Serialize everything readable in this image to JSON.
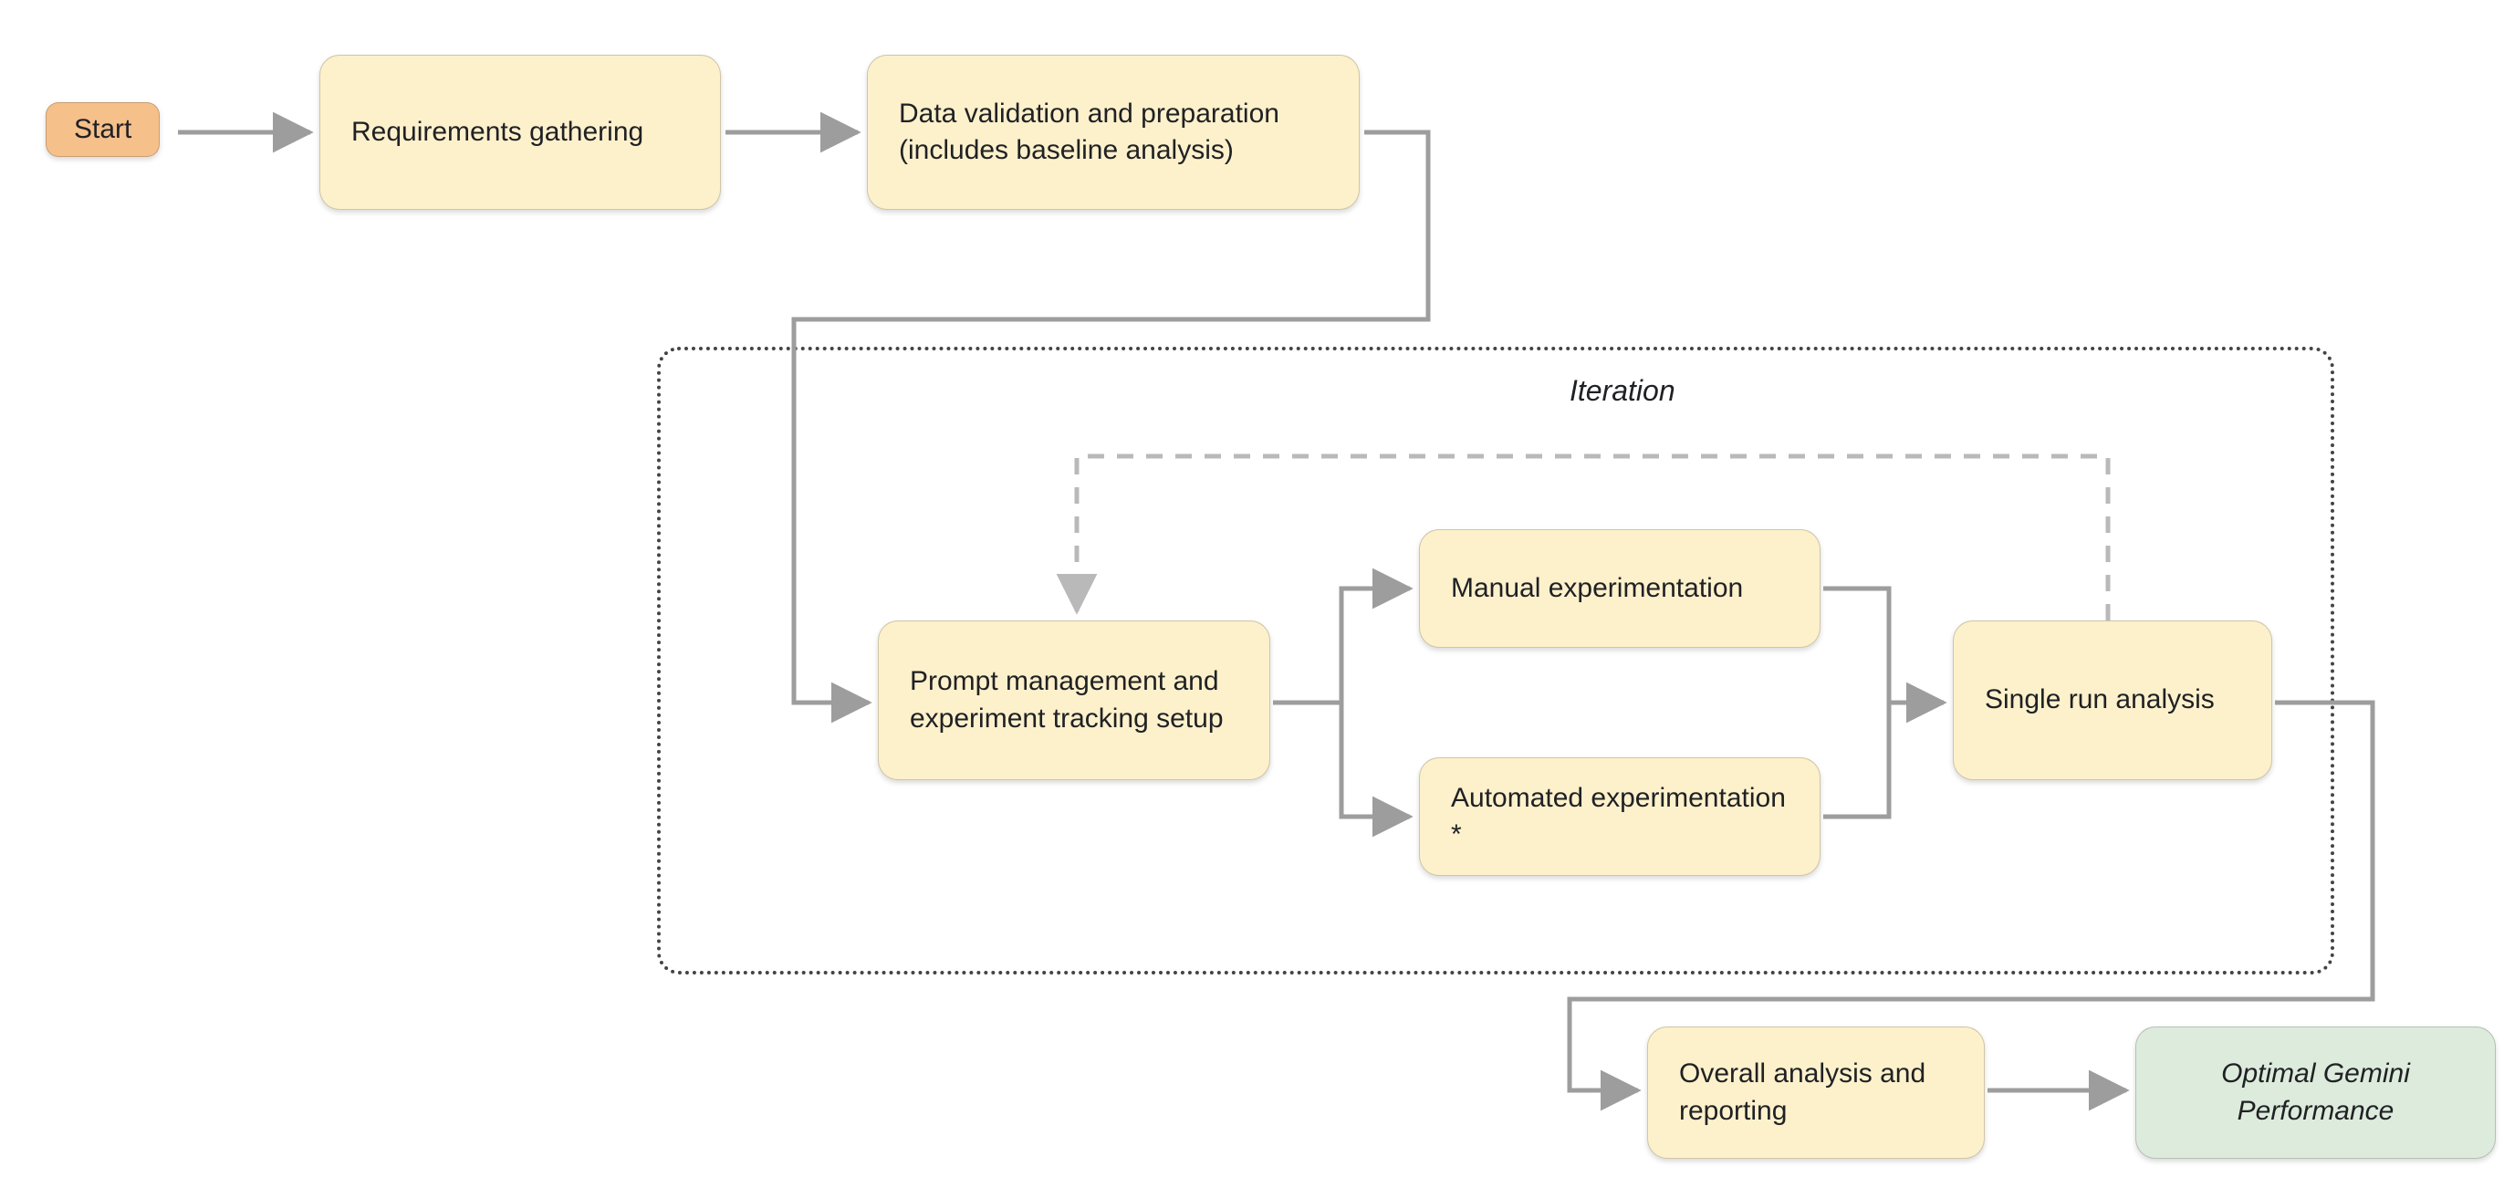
{
  "nodes": {
    "start": "Start",
    "requirements": "Requirements gathering",
    "data_validation": "Data validation and preparation\n(includes baseline analysis)",
    "prompt_mgmt": "Prompt management and experiment tracking setup",
    "manual_exp": "Manual experimentation",
    "auto_exp": "Automated experimentation *",
    "single_run": "Single run analysis",
    "overall": "Overall analysis and reporting",
    "optimal": "Optimal Gemini Performance"
  },
  "labels": {
    "iteration": "Iteration"
  },
  "style": {
    "arrow": "#9d9d9d",
    "yellow": "#FDF1CC",
    "green": "#DDEBDC",
    "start": "#F6C08B"
  }
}
